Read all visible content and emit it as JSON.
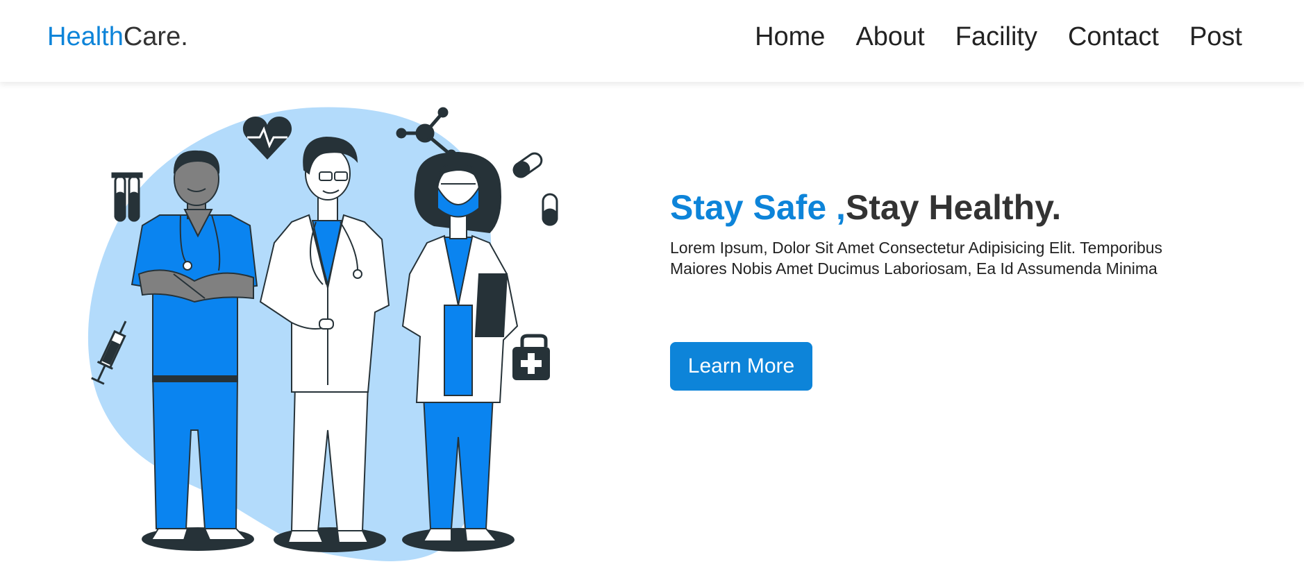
{
  "brand": {
    "part1": "Health",
    "part2": "Care.",
    "accent_color": "#0d84d9"
  },
  "nav": {
    "items": [
      {
        "label": "Home"
      },
      {
        "label": "About"
      },
      {
        "label": "Facility"
      },
      {
        "label": "Contact"
      },
      {
        "label": "Post"
      }
    ]
  },
  "hero": {
    "title_accent": "Stay Safe ,",
    "title_rest": "Stay Healthy.",
    "description_line1": "Lorem Ipsum, Dolor Sit Amet Consectetur Adipisicing Elit. Temporibus",
    "description_line2": "Maiores Nobis Amet Ducimus Laboriosam, Ea Id Assumenda Minima",
    "cta_label": "Learn More",
    "illustration": {
      "subject": "three healthcare workers",
      "icons": [
        "heart-pulse-icon",
        "molecule-icon",
        "test-tubes-icon",
        "pill-icon",
        "syringe-icon",
        "first-aid-kit-icon"
      ],
      "colors": {
        "blob": "#b3dbfb",
        "scrubs": "#0a84f0",
        "dark": "#263238"
      }
    }
  }
}
